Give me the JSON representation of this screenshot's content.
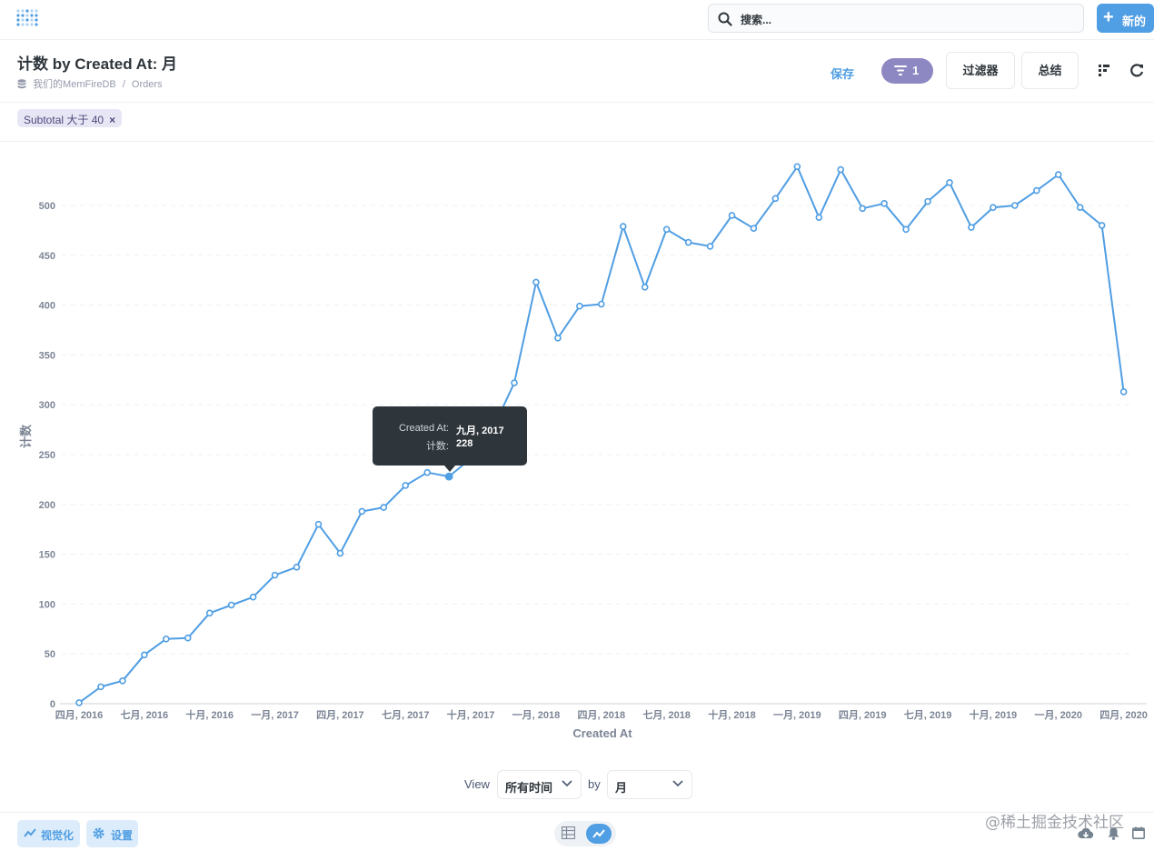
{
  "search": {
    "placeholder": "搜索..."
  },
  "topbar": {
    "new_label": "新的"
  },
  "header": {
    "title": "计数 by Created At: 月",
    "breadcrumb_db": "我们的MemFireDB",
    "breadcrumb_sep": "/",
    "breadcrumb_table": "Orders",
    "save_label": "保存",
    "filter_count": "1",
    "filter_button": "过滤器",
    "summarize_button": "总结"
  },
  "filter_chip": {
    "label": "Subtotal 大于 40",
    "remove": "×"
  },
  "chart_data": {
    "type": "line",
    "xlabel": "Created At",
    "ylabel": "计数",
    "ylim": [
      0,
      550
    ],
    "yticks": [
      0,
      50,
      100,
      150,
      200,
      250,
      300,
      350,
      400,
      450,
      500
    ],
    "x_tick_labels": [
      "四月, 2016",
      "七月, 2016",
      "十月, 2016",
      "一月, 2017",
      "四月, 2017",
      "七月, 2017",
      "十月, 2017",
      "一月, 2018",
      "四月, 2018",
      "七月, 2018",
      "十月, 2018",
      "一月, 2019",
      "四月, 2019",
      "七月, 2019",
      "十月, 2019",
      "一月, 2020",
      "四月, 2020"
    ],
    "grid": true,
    "color": "#509ee3",
    "x": [
      "2016-04",
      "2016-05",
      "2016-06",
      "2016-07",
      "2016-08",
      "2016-09",
      "2016-10",
      "2016-11",
      "2016-12",
      "2017-01",
      "2017-02",
      "2017-03",
      "2017-04",
      "2017-05",
      "2017-06",
      "2017-07",
      "2017-08",
      "2017-09",
      "2017-10",
      "2017-11",
      "2017-12",
      "2018-01",
      "2018-02",
      "2018-03",
      "2018-04",
      "2018-05",
      "2018-06",
      "2018-07",
      "2018-08",
      "2018-09",
      "2018-10",
      "2018-11",
      "2018-12",
      "2019-01",
      "2019-02",
      "2019-03",
      "2019-04",
      "2019-05",
      "2019-06",
      "2019-07",
      "2019-08",
      "2019-09",
      "2019-10",
      "2019-11",
      "2019-12",
      "2020-01",
      "2020-02",
      "2020-03",
      "2020-04"
    ],
    "values": [
      1,
      17,
      23,
      49,
      65,
      66,
      91,
      99,
      107,
      129,
      137,
      180,
      151,
      193,
      197,
      219,
      232,
      228,
      246,
      275,
      322,
      423,
      367,
      399,
      401,
      479,
      418,
      476,
      463,
      459,
      490,
      477,
      507,
      539,
      488,
      536,
      497,
      502,
      476,
      504,
      523,
      478,
      498,
      500,
      515,
      531,
      498,
      480,
      313
    ],
    "highlight_index": 17
  },
  "tooltip": {
    "k1": "Created At:",
    "v1": "九月, 2017",
    "k2": "计数:",
    "v2": "228"
  },
  "view": {
    "view_label": "View",
    "period_value": "所有时间",
    "by_label": "by",
    "unit_value": "月"
  },
  "footer": {
    "visualize_label": "视觉化",
    "settings_label": "设置"
  },
  "watermark": "@稀土掘金技术社区"
}
